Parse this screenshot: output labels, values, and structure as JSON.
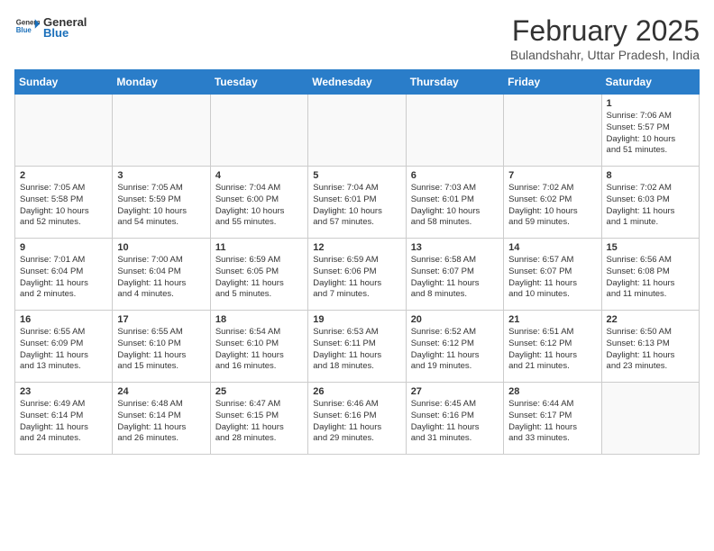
{
  "header": {
    "logo_general": "General",
    "logo_blue": "Blue",
    "month_title": "February 2025",
    "location": "Bulandshahr, Uttar Pradesh, India"
  },
  "weekdays": [
    "Sunday",
    "Monday",
    "Tuesday",
    "Wednesday",
    "Thursday",
    "Friday",
    "Saturday"
  ],
  "weeks": [
    [
      {
        "day": "",
        "info": ""
      },
      {
        "day": "",
        "info": ""
      },
      {
        "day": "",
        "info": ""
      },
      {
        "day": "",
        "info": ""
      },
      {
        "day": "",
        "info": ""
      },
      {
        "day": "",
        "info": ""
      },
      {
        "day": "1",
        "info": "Sunrise: 7:06 AM\nSunset: 5:57 PM\nDaylight: 10 hours\nand 51 minutes."
      }
    ],
    [
      {
        "day": "2",
        "info": "Sunrise: 7:05 AM\nSunset: 5:58 PM\nDaylight: 10 hours\nand 52 minutes."
      },
      {
        "day": "3",
        "info": "Sunrise: 7:05 AM\nSunset: 5:59 PM\nDaylight: 10 hours\nand 54 minutes."
      },
      {
        "day": "4",
        "info": "Sunrise: 7:04 AM\nSunset: 6:00 PM\nDaylight: 10 hours\nand 55 minutes."
      },
      {
        "day": "5",
        "info": "Sunrise: 7:04 AM\nSunset: 6:01 PM\nDaylight: 10 hours\nand 57 minutes."
      },
      {
        "day": "6",
        "info": "Sunrise: 7:03 AM\nSunset: 6:01 PM\nDaylight: 10 hours\nand 58 minutes."
      },
      {
        "day": "7",
        "info": "Sunrise: 7:02 AM\nSunset: 6:02 PM\nDaylight: 10 hours\nand 59 minutes."
      },
      {
        "day": "8",
        "info": "Sunrise: 7:02 AM\nSunset: 6:03 PM\nDaylight: 11 hours\nand 1 minute."
      }
    ],
    [
      {
        "day": "9",
        "info": "Sunrise: 7:01 AM\nSunset: 6:04 PM\nDaylight: 11 hours\nand 2 minutes."
      },
      {
        "day": "10",
        "info": "Sunrise: 7:00 AM\nSunset: 6:04 PM\nDaylight: 11 hours\nand 4 minutes."
      },
      {
        "day": "11",
        "info": "Sunrise: 6:59 AM\nSunset: 6:05 PM\nDaylight: 11 hours\nand 5 minutes."
      },
      {
        "day": "12",
        "info": "Sunrise: 6:59 AM\nSunset: 6:06 PM\nDaylight: 11 hours\nand 7 minutes."
      },
      {
        "day": "13",
        "info": "Sunrise: 6:58 AM\nSunset: 6:07 PM\nDaylight: 11 hours\nand 8 minutes."
      },
      {
        "day": "14",
        "info": "Sunrise: 6:57 AM\nSunset: 6:07 PM\nDaylight: 11 hours\nand 10 minutes."
      },
      {
        "day": "15",
        "info": "Sunrise: 6:56 AM\nSunset: 6:08 PM\nDaylight: 11 hours\nand 11 minutes."
      }
    ],
    [
      {
        "day": "16",
        "info": "Sunrise: 6:55 AM\nSunset: 6:09 PM\nDaylight: 11 hours\nand 13 minutes."
      },
      {
        "day": "17",
        "info": "Sunrise: 6:55 AM\nSunset: 6:10 PM\nDaylight: 11 hours\nand 15 minutes."
      },
      {
        "day": "18",
        "info": "Sunrise: 6:54 AM\nSunset: 6:10 PM\nDaylight: 11 hours\nand 16 minutes."
      },
      {
        "day": "19",
        "info": "Sunrise: 6:53 AM\nSunset: 6:11 PM\nDaylight: 11 hours\nand 18 minutes."
      },
      {
        "day": "20",
        "info": "Sunrise: 6:52 AM\nSunset: 6:12 PM\nDaylight: 11 hours\nand 19 minutes."
      },
      {
        "day": "21",
        "info": "Sunrise: 6:51 AM\nSunset: 6:12 PM\nDaylight: 11 hours\nand 21 minutes."
      },
      {
        "day": "22",
        "info": "Sunrise: 6:50 AM\nSunset: 6:13 PM\nDaylight: 11 hours\nand 23 minutes."
      }
    ],
    [
      {
        "day": "23",
        "info": "Sunrise: 6:49 AM\nSunset: 6:14 PM\nDaylight: 11 hours\nand 24 minutes."
      },
      {
        "day": "24",
        "info": "Sunrise: 6:48 AM\nSunset: 6:14 PM\nDaylight: 11 hours\nand 26 minutes."
      },
      {
        "day": "25",
        "info": "Sunrise: 6:47 AM\nSunset: 6:15 PM\nDaylight: 11 hours\nand 28 minutes."
      },
      {
        "day": "26",
        "info": "Sunrise: 6:46 AM\nSunset: 6:16 PM\nDaylight: 11 hours\nand 29 minutes."
      },
      {
        "day": "27",
        "info": "Sunrise: 6:45 AM\nSunset: 6:16 PM\nDaylight: 11 hours\nand 31 minutes."
      },
      {
        "day": "28",
        "info": "Sunrise: 6:44 AM\nSunset: 6:17 PM\nDaylight: 11 hours\nand 33 minutes."
      },
      {
        "day": "",
        "info": ""
      }
    ]
  ]
}
